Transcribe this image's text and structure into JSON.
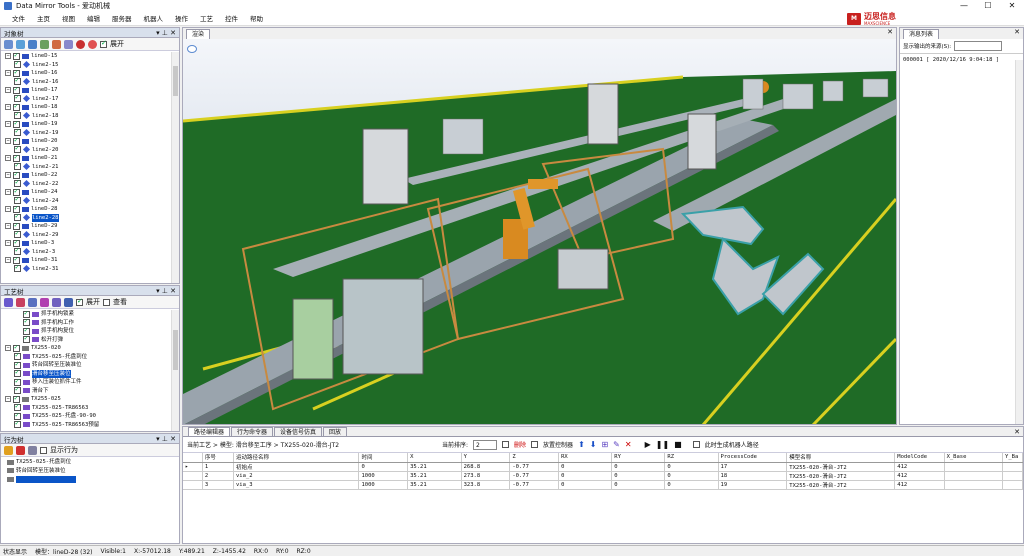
{
  "window": {
    "title": "Data Mirror Tools - 爱动机械",
    "min": "—",
    "max": "☐",
    "close": "✕"
  },
  "menu": [
    "文件",
    "主页",
    "视图",
    "编辑",
    "服务器",
    "机器人",
    "操作",
    "工艺",
    "控件",
    "帮助"
  ],
  "brand": {
    "name": "迈思信息",
    "sub": "MAXSCIENCE"
  },
  "object_tree": {
    "title": "对象树",
    "expand_label": "展开",
    "nodes": [
      {
        "label": "lineD-15",
        "lvl": 0
      },
      {
        "label": "line2-15",
        "lvl": 1
      },
      {
        "label": "lineD-16",
        "lvl": 0
      },
      {
        "label": "line2-16",
        "lvl": 1
      },
      {
        "label": "lineD-17",
        "lvl": 0
      },
      {
        "label": "line2-17",
        "lvl": 1
      },
      {
        "label": "lineD-18",
        "lvl": 0
      },
      {
        "label": "line2-18",
        "lvl": 1
      },
      {
        "label": "lineD-19",
        "lvl": 0
      },
      {
        "label": "line2-19",
        "lvl": 1
      },
      {
        "label": "lineD-20",
        "lvl": 0
      },
      {
        "label": "line2-20",
        "lvl": 1
      },
      {
        "label": "lineD-21",
        "lvl": 0
      },
      {
        "label": "line2-21",
        "lvl": 1
      },
      {
        "label": "lineD-22",
        "lvl": 0
      },
      {
        "label": "line2-22",
        "lvl": 1
      },
      {
        "label": "lineD-24",
        "lvl": 0
      },
      {
        "label": "line2-24",
        "lvl": 1
      },
      {
        "label": "lineD-28",
        "lvl": 0
      },
      {
        "label": "line2-28",
        "lvl": 1,
        "sel": true
      },
      {
        "label": "lineD-29",
        "lvl": 0
      },
      {
        "label": "line2-29",
        "lvl": 1
      },
      {
        "label": "lineD-3",
        "lvl": 0
      },
      {
        "label": "line2-3",
        "lvl": 1
      },
      {
        "label": "lineD-31",
        "lvl": 0
      },
      {
        "label": "line2-31",
        "lvl": 1
      }
    ]
  },
  "process_tree": {
    "title": "工艺树",
    "expand_label": "展开",
    "view_label": "查看",
    "nodes": [
      {
        "label": "抓手机构锁紧",
        "lvl": 2
      },
      {
        "label": "抓手机构工作",
        "lvl": 2
      },
      {
        "label": "抓手机构复位",
        "lvl": 2
      },
      {
        "label": "松开打弹",
        "lvl": 2
      },
      {
        "label": "TX255-020",
        "lvl": 0
      },
      {
        "label": "TX255-025-托盘到位",
        "lvl": 1
      },
      {
        "label": "转台回转至压装准位",
        "lvl": 1
      },
      {
        "label": "滑台移至压装位",
        "lvl": 1,
        "sel": true
      },
      {
        "label": "移入压装位抓件工件",
        "lvl": 1
      },
      {
        "label": "滑台下",
        "lvl": 1
      },
      {
        "label": "TX255-025",
        "lvl": 0
      },
      {
        "label": "TX255-025-TR86563",
        "lvl": 1
      },
      {
        "label": "TX255-025-托盘-90-90",
        "lvl": 1
      },
      {
        "label": "TX255-025-TR86563预留",
        "lvl": 1
      }
    ]
  },
  "behavior_tree": {
    "title": "行为树",
    "show_label": "显示行为",
    "nodes": [
      {
        "label": "TX255-025-托盘到位",
        "lvl": 0
      },
      {
        "label": "转台回转至压装准位",
        "lvl": 0
      },
      {
        "label": "",
        "lvl": 0,
        "sel": true
      }
    ]
  },
  "viewport": {
    "tab": "渲染"
  },
  "messages": {
    "title": "消息列表",
    "filter_label": "显示输出的来源(S):",
    "lines": [
      "000001 [ 2020/12/16 9:04:18 ]"
    ]
  },
  "bottom": {
    "tabs": [
      "路径编辑器",
      "行为命令器",
      "设备信号仿真",
      "回放"
    ],
    "breadcrumb": "当前工艺 > 模型: 滑台移至工序 > TX255-020-滑台-JT2",
    "order_label": "当前排序:",
    "order_value": "2",
    "delete_label": "删除",
    "ctrl_label": "放置控制器",
    "robot_label": "此时生成机器人路径",
    "columns": [
      "",
      "序号",
      "运动路径名称",
      "时间",
      "X",
      "Y",
      "Z",
      "RX",
      "RY",
      "RZ",
      "ProcessCode",
      "模型名称",
      "ModelCode",
      "X_Base",
      "Y_Ba"
    ],
    "rows": [
      [
        "▸",
        "1",
        "初始点",
        "0",
        "35.21",
        "268.8",
        "-0.77",
        "0",
        "0",
        "0",
        "17",
        "TX255-020-滑台-JT2",
        "412",
        "",
        ""
      ],
      [
        "",
        "2",
        "via_2",
        "1000",
        "35.21",
        "273.8",
        "-0.77",
        "0",
        "0",
        "0",
        "18",
        "TX255-020-滑台-JT2",
        "412",
        "",
        ""
      ],
      [
        "",
        "3",
        "via_3",
        "1000",
        "35.21",
        "323.8",
        "-0.77",
        "0",
        "0",
        "0",
        "19",
        "TX255-020-滑台-JT2",
        "412",
        "",
        ""
      ]
    ]
  },
  "status": [
    "状态显示",
    "模型：lineD-28 (32)",
    "Visible:1",
    "X:-57012.18",
    "Y:489.21",
    "Z:-1455.42",
    "RX:0",
    "RY:0",
    "RZ:0"
  ]
}
